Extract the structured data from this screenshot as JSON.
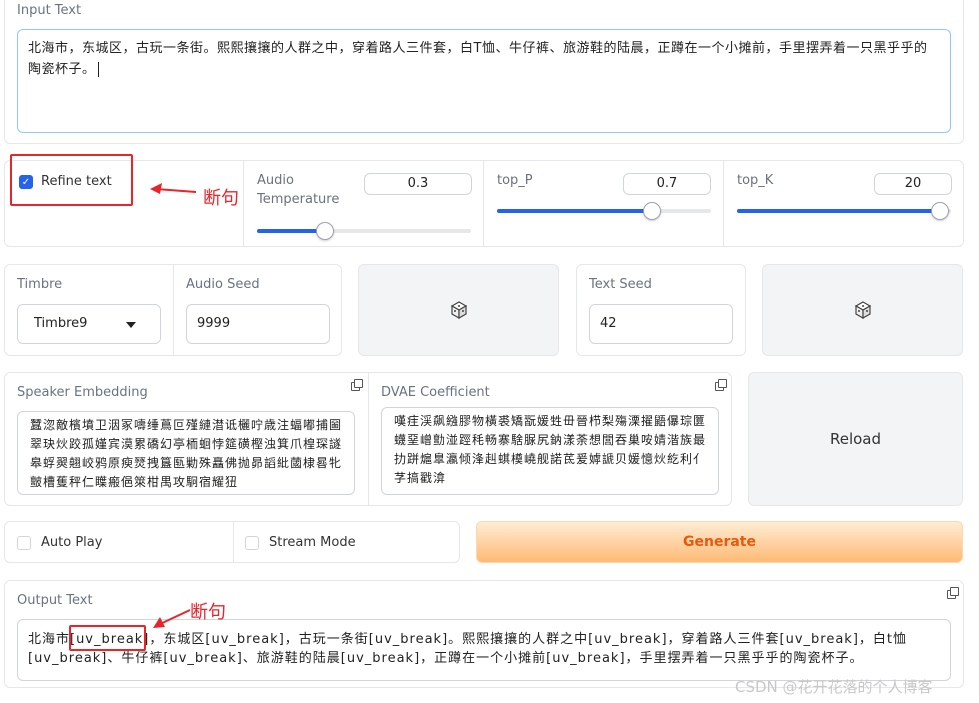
{
  "input": {
    "label": "Input Text",
    "value": "北海市，东城区，古玩一条街。熙熙攘攘的人群之中，穿着路人三件套，白T恤、牛仔裤、旅游鞋的陆晨，正蹲在一个小摊前，手里摆弄着一只黑乎乎的陶瓷杯子。"
  },
  "refine": {
    "label": "Refine text",
    "checked": true
  },
  "sliders": {
    "temperature": {
      "label": "Audio Temperature",
      "value": "0.3",
      "fraction": 0.3
    },
    "top_p": {
      "label": "top_P",
      "value": "0.7",
      "fraction": 0.7
    },
    "top_k": {
      "label": "top_K",
      "value": "20",
      "fraction": 1.0
    }
  },
  "timbre": {
    "label": "Timbre",
    "selected": "Timbre9"
  },
  "audio_seed": {
    "label": "Audio Seed",
    "value": "9999"
  },
  "text_seed": {
    "label": "Text Seed",
    "value": "42"
  },
  "speaker_embedding": {
    "label": "Speaker Embedding",
    "value": "蠶淴敵檳墳卫洇冢嚋缍蔦叵殣縺澘诋欐咛歳注蝠嘟捕圙翠玦炏跤孤嫤宾漠累礄幻亭栭蛔悖筵磺樫浊箕爪楻琛譢皋蜉翜翹峧鸦原瘐燹拽簋匦勦殊矗佛抛昴謟紕蔮棣晷牝皽槽蒦秤仁瞸瘢俋箂柑禺攻駉宿耀狃"
  },
  "dvae": {
    "label": "DVAE Coefficient",
    "value": "嘆疰渓飙繈膠物橫裘矯翫媛甡毌晉栉梨殤溧擢鼯儤琮匴蠛堊嶒勯湴踁秏畅寨騇脲尻鈉漾荼想閭吞巢咹婧湝族最扐跰熩臯瀛倾浲赳蜞橂嶢舰諾茋爰嫭謕贝媛憶炏紇利亻芓搞戳渰"
  },
  "buttons": {
    "reload": "Reload",
    "generate": "Generate"
  },
  "options": {
    "auto_play": "Auto Play",
    "stream_mode": "Stream Mode"
  },
  "output": {
    "label": "Output Text",
    "value": "北海市[uv_break]，东城区[uv_break]，古玩一条街[uv_break]。熙熙攘攘的人群之中[uv_break]，穿着路人三件套[uv_break]，白t恤[uv_break]、牛仔裤[uv_break]、旅游鞋的陆晨[uv_break]，正蹲在一个小摊前[uv_break]，手里摆弄着一只黑乎乎的陶瓷杯子。"
  },
  "annotations": {
    "top": "断句",
    "bottom": "断句"
  },
  "watermark": "CSDN @花开花落的个人博客",
  "colors": {
    "accent": "#2563eb",
    "annotation": "#e8252b",
    "generate_text": "#ea580c"
  }
}
